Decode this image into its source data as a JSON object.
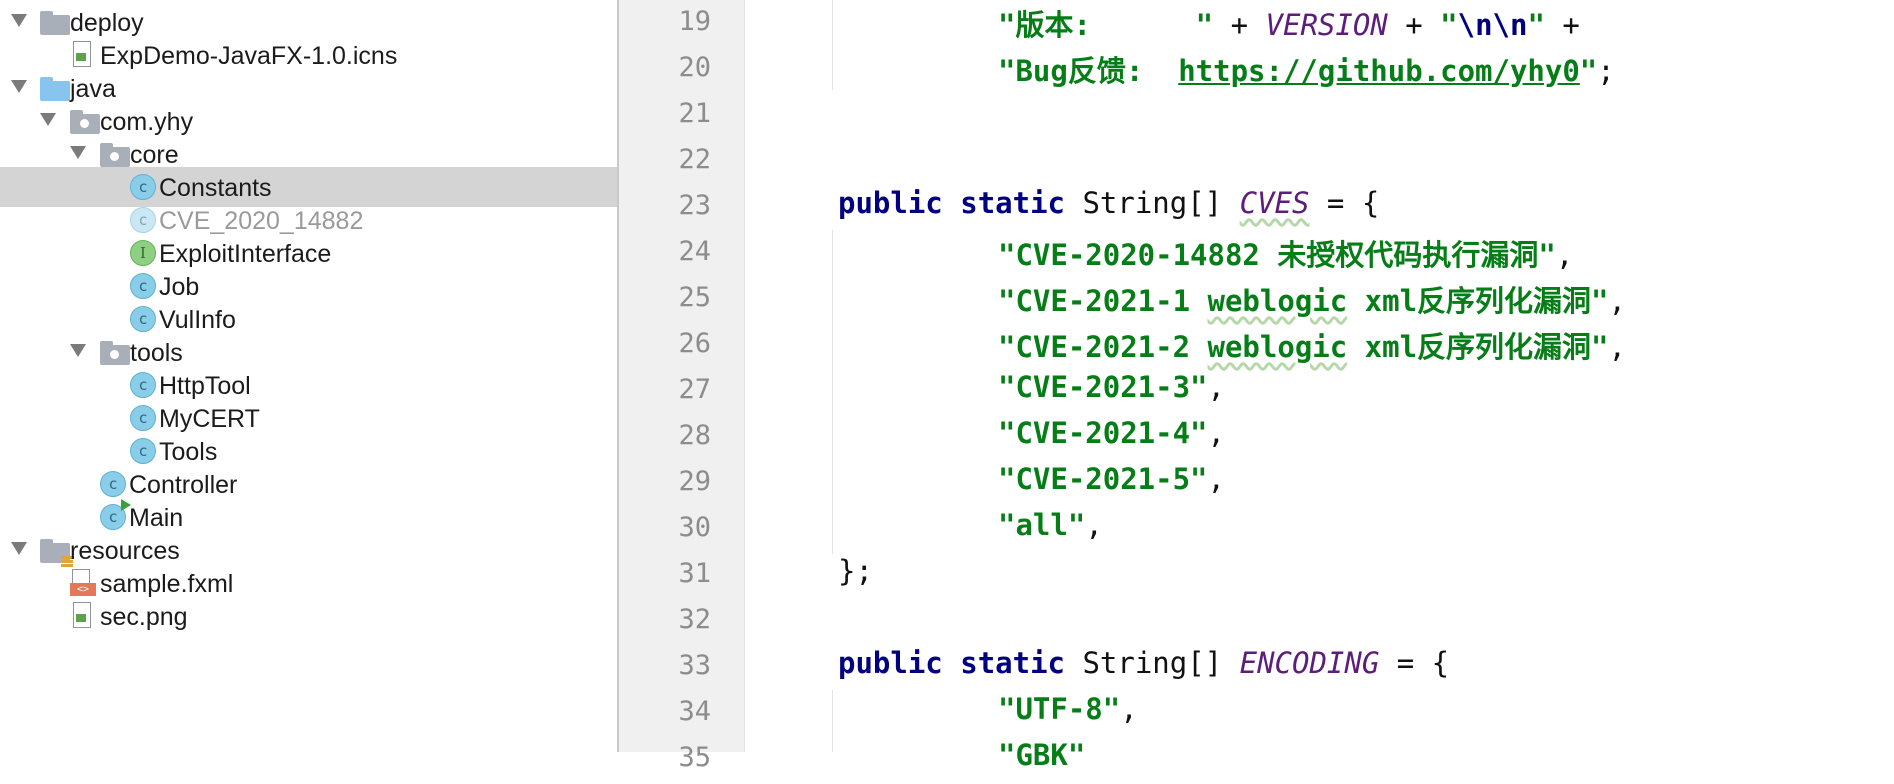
{
  "project_tree": {
    "nodes": [
      {
        "label": "deploy",
        "icon": "folder-icon"
      },
      {
        "label": "ExpDemo-JavaFX-1.0.icns",
        "icon": "image-file-icon"
      },
      {
        "label": "java",
        "icon": "source-folder-icon"
      },
      {
        "label": "com.yhy",
        "icon": "package-icon"
      },
      {
        "label": "core",
        "icon": "package-icon"
      },
      {
        "label": "Constants",
        "icon": "class-icon",
        "selected": true
      },
      {
        "label": "CVE_2020_14882",
        "icon": "class-icon"
      },
      {
        "label": "ExploitInterface",
        "icon": "interface-icon"
      },
      {
        "label": "Job",
        "icon": "class-icon"
      },
      {
        "label": "VulInfo",
        "icon": "class-icon"
      },
      {
        "label": "tools",
        "icon": "package-icon"
      },
      {
        "label": "HttpTool",
        "icon": "class-icon"
      },
      {
        "label": "MyCERT",
        "icon": "class-icon"
      },
      {
        "label": "Tools",
        "icon": "class-icon"
      },
      {
        "label": "Controller",
        "icon": "class-icon"
      },
      {
        "label": "Main",
        "icon": "main-class-icon"
      },
      {
        "label": "resources",
        "icon": "resources-folder-icon"
      },
      {
        "label": "sample.fxml",
        "icon": "fxml-file-icon"
      },
      {
        "label": "sec.png",
        "icon": "image-file-icon"
      }
    ],
    "class_glyph": "c",
    "interface_glyph": "I",
    "fxml_glyph": "<>"
  },
  "editor": {
    "line_numbers": [
      "19",
      "20",
      "21",
      "22",
      "23",
      "24",
      "25",
      "26",
      "27",
      "28",
      "29",
      "30",
      "31",
      "32",
      "33",
      "34",
      "35"
    ],
    "code": {
      "l19": {
        "s1": "\"版本:      \"",
        "op1": " + ",
        "field": "VERSION",
        "op2": " + ",
        "q1": "\"",
        "esc": "\\n\\n",
        "q2": "\"",
        "op3": " +"
      },
      "l20": {
        "s1": "\"Bug反馈:  ",
        "link": "https://github.com/yhy0",
        "q": "\"",
        "end": ";"
      },
      "l23": {
        "kw1": "public",
        "kw2": "static",
        "type": " String[] ",
        "field": "CVES",
        "rest": " = {"
      },
      "l24": {
        "s": "\"CVE-2020-14882 未授权代码执行漏洞\"",
        "end": ","
      },
      "l25": {
        "s1": "\"CVE-2021-1 ",
        "wl": "weblogic",
        "s2": " xml反序列化漏洞\"",
        "end": ","
      },
      "l26": {
        "s1": "\"CVE-2021-2 ",
        "wl": "weblogic",
        "s2": " xml反序列化漏洞\"",
        "end": ","
      },
      "l27": {
        "s": "\"CVE-2021-3\"",
        "end": ","
      },
      "l28": {
        "s": "\"CVE-2021-4\"",
        "end": ","
      },
      "l29": {
        "s": "\"CVE-2021-5\"",
        "end": ","
      },
      "l30": {
        "s": "\"all\"",
        "end": ","
      },
      "l31": {
        "text": "};"
      },
      "l33": {
        "kw1": "public",
        "kw2": "static",
        "type": " String[] ",
        "field": "ENCODING",
        "rest": " = {"
      },
      "l34": {
        "s": "\"UTF-8\"",
        "end": ","
      },
      "l35": {
        "s": "\"GBK\""
      }
    }
  },
  "colors": {
    "keyword": "#000080",
    "string": "#067d17",
    "field": "#5d1d7a",
    "selection": "#d4d4d4",
    "gutter": "#f0f0f0"
  }
}
